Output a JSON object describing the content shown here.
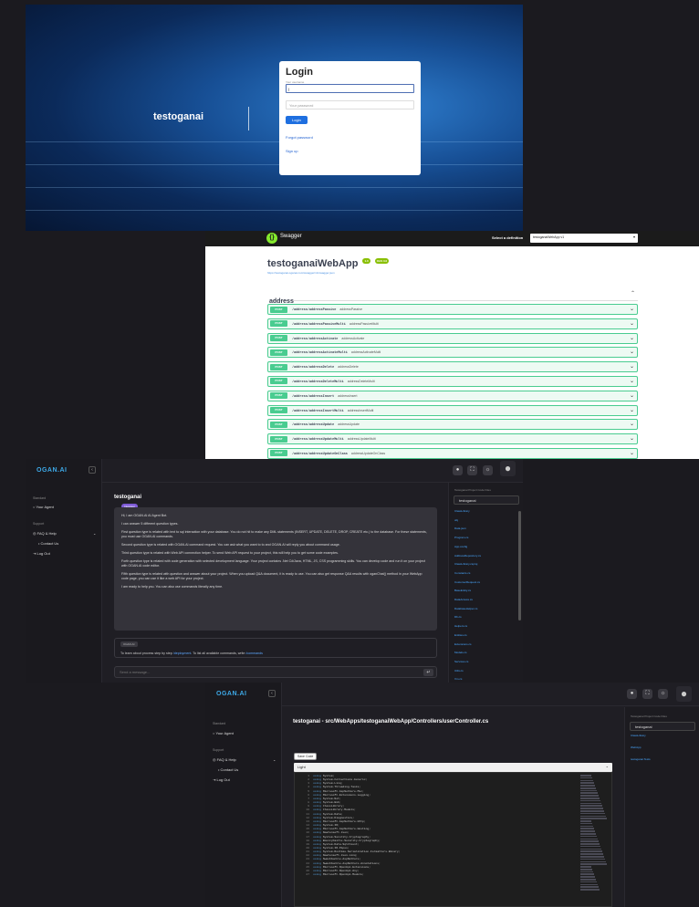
{
  "login": {
    "brand": "testoganai",
    "title": "Login",
    "username_label": "Your username",
    "username_value": "|",
    "password_placeholder": "Your password",
    "login_button": "Login",
    "forgot_link": "Forgot password",
    "signup_link": "Sign up"
  },
  "swagger": {
    "logo_text": "Swagger",
    "definition_label": "Select a definition",
    "definition_value": "testoganaiWebApp v1",
    "title": "testoganaiWebApp",
    "version_badge": "1.0",
    "oas_badge": "OAS 3.0",
    "spec_url": "https://testoganai.oganai.com/swagger/v1/swagger.json",
    "tag": "address",
    "operations": [
      {
        "method": "POST",
        "path": "/address/addressPassive",
        "summary": "addressPassive"
      },
      {
        "method": "POST",
        "path": "/address/addressPassiveMulti",
        "summary": "addressPassiveMulti"
      },
      {
        "method": "POST",
        "path": "/address/addressActivate",
        "summary": "addressActivate"
      },
      {
        "method": "POST",
        "path": "/address/addressActivateMulti",
        "summary": "addressActivateMulti"
      },
      {
        "method": "POST",
        "path": "/address/addressDelete",
        "summary": "addressDelete"
      },
      {
        "method": "POST",
        "path": "/address/addressDeleteMulti",
        "summary": "addressDeleteMulti"
      },
      {
        "method": "POST",
        "path": "/address/addressInsert",
        "summary": "addressInsert"
      },
      {
        "method": "POST",
        "path": "/address/addressInsertMulti",
        "summary": "addressInsertMulti"
      },
      {
        "method": "POST",
        "path": "/address/addressUpdate",
        "summary": "addressUpdate"
      },
      {
        "method": "POST",
        "path": "/address/addressUpdateMulti",
        "summary": "addressUpdateMulti"
      },
      {
        "method": "POST",
        "path": "/address/addressUpdateOnClass",
        "summary": "addressUpdateOnClass"
      }
    ]
  },
  "app": {
    "logo": "OGAN.AI",
    "sidebar": {
      "section1": "Standard",
      "your_agent": "Your Agent",
      "section2": "Support",
      "faq": "FAQ & Help",
      "contact": "Contact Us",
      "logout": "Log Out"
    },
    "file_tree": {
      "heading": "Testoganai Project Code Files",
      "project": "testoganai",
      "items": [
        "ClassLibrary",
        "obj",
        "Data.json",
        "Program.cs",
        "App.config",
        "AddressRepository.cs",
        "ClassLibrary.csproj",
        "Constants.cs",
        "CustomerRequest.cs",
        "BaseEntity.cs",
        "DataAccess.cs",
        "DatabaseHelper.cs",
        "Db.cs",
        "Helpers.cs",
        "Entities.cs",
        "Extensions.cs",
        "Models.cs",
        "Services.cs",
        "Utils.cs",
        "Vm.cs"
      ]
    }
  },
  "chat": {
    "title": "testoganai",
    "chip": "Intégrasi",
    "paragraphs": [
      "Hi, I am OGAN.AI AI Agent Bot.",
      "I can answer 5 different question types.",
      "First question type is related with text to sql interaction with your database. You do not hit to make any DML statements (INSERT, UPDATE, DELETE, DROP, CREATE etc.) to the database. For these statements, you must use OGAN.AI commands.",
      "Second question type is related with OGAN.AI command request. You can ask what you want to to and OGAN.AI will reply you about command usage.",
      "Third question type is related with Web API connection helper. To send Web API request to your project, this will help you to get some code examples.",
      "Forth question type is related with code generation with selected development language. Your project contains .Net C#/Java, HTML, JS, CSS programming skills. You can develop code and run it on your project with OGAN.AI code editor.",
      "Fifth question type is related with question and answer about your project. When you upload Q&A document, it is ready to use. You can also get response Q&A results with oganChat() method in your WebApp code page, you can use it like a web API for your project.",
      "I am ready to help you. You can also use commands literally any time."
    ],
    "tip_label": "OGAN.AI",
    "tip_text_a": "To learn about process step by step ",
    "tip_link_a": "/deployment",
    "tip_text_b": ". To list all available commands, write ",
    "tip_link_b": "/commands",
    "input_placeholder": "Send a message...",
    "send_icon": "enter-icon"
  },
  "code": {
    "path": "testoganai - src/WebApps/testoganaiWebApp/Controllers/userController.cs",
    "save_button": "Save Code",
    "language": "Light",
    "file_tree_items": [
      "ClassLibrary",
      "WebApp",
      "testoganai.Tests"
    ],
    "lines": [
      [
        "using",
        " System;"
      ],
      [
        "using",
        " System.Collections.Generic;"
      ],
      [
        "using",
        " System.Linq;"
      ],
      [
        "using",
        " System.Threading.Tasks;"
      ],
      [
        "using",
        " Microsoft.AspNetCore.Mvc;"
      ],
      [
        "using",
        " Microsoft.Extensions.Logging;"
      ],
      [
        "using",
        " System.Net;"
      ],
      [
        "using",
        " System.Web;"
      ],
      [
        "using",
        " ClassLibrary;"
      ],
      [
        "using",
        " ClassLibrary.Models;"
      ],
      [
        "using",
        " System.Data;"
      ],
      [
        "using",
        " System.Diagnostics;"
      ],
      [
        "using",
        " Microsoft.AspNetCore.Http;"
      ],
      [
        "using",
        " System.IO;"
      ],
      [
        "using",
        " Microsoft.AspNetCore.Hosting;"
      ],
      [
        "using",
        " Newtonsoft.Json;"
      ],
      [
        "using",
        " System.Security.Cryptography;"
      ],
      [
        "using",
        " BouncyCastle.Security.Cryptography;"
      ],
      [
        "using",
        " System.Data.SqlClient;"
      ],
      [
        "using",
        " System.IO.Pipes;"
      ],
      [
        "using",
        " System.Runtime.Serialization.Formatters.Binary;"
      ],
      [
        "using",
        " Newtonsoft.Json.Linq;"
      ],
      [
        "using",
        " Swashbuckle.AspNetCore;"
      ],
      [
        "using",
        " Swashbuckle.AspNetCore.Annotations;"
      ],
      [
        "using",
        " Microsoft.OpenApi.Extensions;"
      ],
      [
        "using",
        " Microsoft.OpenApi.Any;"
      ],
      [
        "using",
        " Microsoft.OpenApi.Models;"
      ]
    ]
  }
}
